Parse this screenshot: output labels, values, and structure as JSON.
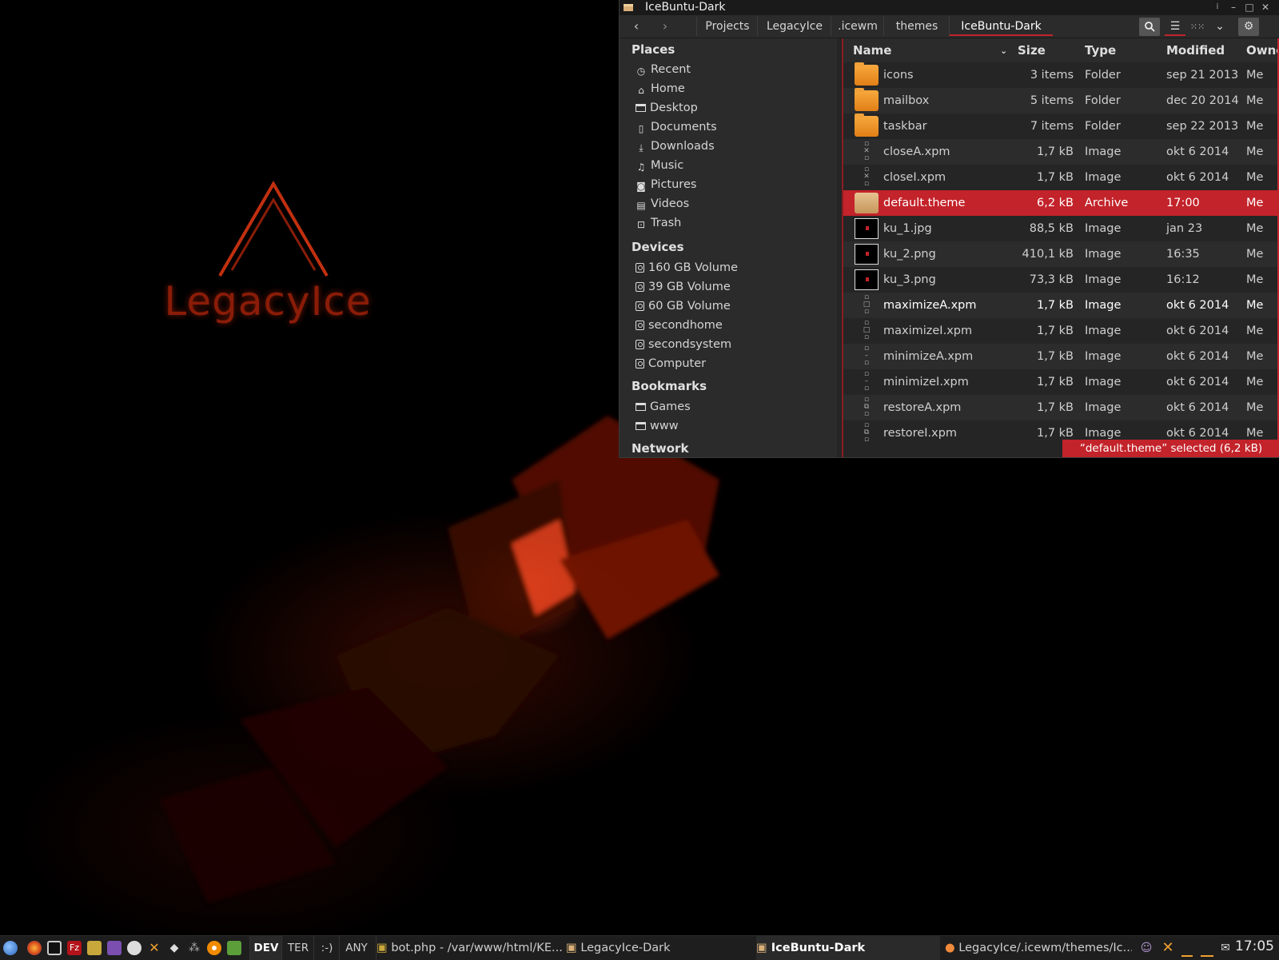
{
  "desktop": {
    "logo_text": "LegacyIce",
    "accent_color": "#c3232a"
  },
  "window": {
    "title": "IceBuntu-Dark",
    "controls": {
      "minimize": "–",
      "maximize": "□",
      "close": "✕"
    },
    "nav": {
      "back": "‹",
      "forward": "›"
    },
    "breadcrumbs": [
      "Projects",
      "LegacyIce",
      ".icewm",
      "themes",
      "IceBuntu-Dark"
    ],
    "toolbar_icons": [
      "search-icon",
      "list-view-icon",
      "grid-view-icon",
      "chevron-down-icon",
      "gear-icon"
    ]
  },
  "sidebar": {
    "places_title": "Places",
    "places": [
      "Recent",
      "Home",
      "Desktop",
      "Documents",
      "Downloads",
      "Music",
      "Pictures",
      "Videos",
      "Trash"
    ],
    "devices_title": "Devices",
    "devices": [
      "160 GB Volume",
      "39 GB Volume",
      "60 GB Volume",
      "secondhome",
      "secondsystem",
      "Computer"
    ],
    "bookmarks_title": "Bookmarks",
    "bookmarks": [
      "Games",
      "www"
    ],
    "network_title": "Network"
  },
  "filelist": {
    "columns": {
      "name": "Name",
      "size": "Size",
      "type": "Type",
      "modified": "Modified",
      "owner": "Owne"
    },
    "rows": [
      {
        "name": "icons",
        "size": "3 items",
        "type": "Folder",
        "modified": "sep 21 2013",
        "owner": "Me",
        "icon": "folder-icon"
      },
      {
        "name": "mailbox",
        "size": "5 items",
        "type": "Folder",
        "modified": "dec 20 2014",
        "owner": "Me",
        "icon": "folder-icon"
      },
      {
        "name": "taskbar",
        "size": "7 items",
        "type": "Folder",
        "modified": "sep 22 2013",
        "owner": "Me",
        "icon": "folder-icon"
      },
      {
        "name": "closeA.xpm",
        "size": "1,7 kB",
        "type": "Image",
        "modified": "okt 6 2014",
        "owner": "Me",
        "icon": "xpm-icon"
      },
      {
        "name": "closeI.xpm",
        "size": "1,7 kB",
        "type": "Image",
        "modified": "okt 6 2014",
        "owner": "Me",
        "icon": "xpm-icon"
      },
      {
        "name": "default.theme",
        "size": "6,2 kB",
        "type": "Archive",
        "modified": "17:00",
        "owner": "Me",
        "icon": "archive-icon"
      },
      {
        "name": "ku_1.jpg",
        "size": "88,5 kB",
        "type": "Image",
        "modified": "jan 23",
        "owner": "Me",
        "icon": "image-thumbnail-icon"
      },
      {
        "name": "ku_2.png",
        "size": "410,1 kB",
        "type": "Image",
        "modified": "16:35",
        "owner": "Me",
        "icon": "image-thumbnail-icon"
      },
      {
        "name": "ku_3.png",
        "size": "73,3 kB",
        "type": "Image",
        "modified": "16:12",
        "owner": "Me",
        "icon": "image-thumbnail-icon"
      },
      {
        "name": "maximizeA.xpm",
        "size": "1,7 kB",
        "type": "Image",
        "modified": "okt 6 2014",
        "owner": "Me",
        "icon": "xpm-icon"
      },
      {
        "name": "maximizeI.xpm",
        "size": "1,7 kB",
        "type": "Image",
        "modified": "okt 6 2014",
        "owner": "Me",
        "icon": "xpm-icon"
      },
      {
        "name": "minimizeA.xpm",
        "size": "1,7 kB",
        "type": "Image",
        "modified": "okt 6 2014",
        "owner": "Me",
        "icon": "xpm-icon"
      },
      {
        "name": "minimizeI.xpm",
        "size": "1,7 kB",
        "type": "Image",
        "modified": "okt 6 2014",
        "owner": "Me",
        "icon": "xpm-icon"
      },
      {
        "name": "restoreA.xpm",
        "size": "1,7 kB",
        "type": "Image",
        "modified": "okt 6 2014",
        "owner": "Me",
        "icon": "xpm-icon"
      },
      {
        "name": "restoreI.xpm",
        "size": "1,7 kB",
        "type": "Image",
        "modified": "okt 6 2014",
        "owner": "Me",
        "icon": "xpm-icon"
      }
    ],
    "status": "“default.theme” selected (6,2 kB)"
  },
  "taskbar": {
    "workspaces": [
      "DEV",
      "TER",
      ":-)",
      "ANY"
    ],
    "tasks": [
      "bot.php - /var/www/html/KE...",
      "LegacyIce-Dark",
      "IceBuntu-Dark",
      "LegacyIce/.icewm/themes/Ic..."
    ],
    "clock": "17:05"
  }
}
